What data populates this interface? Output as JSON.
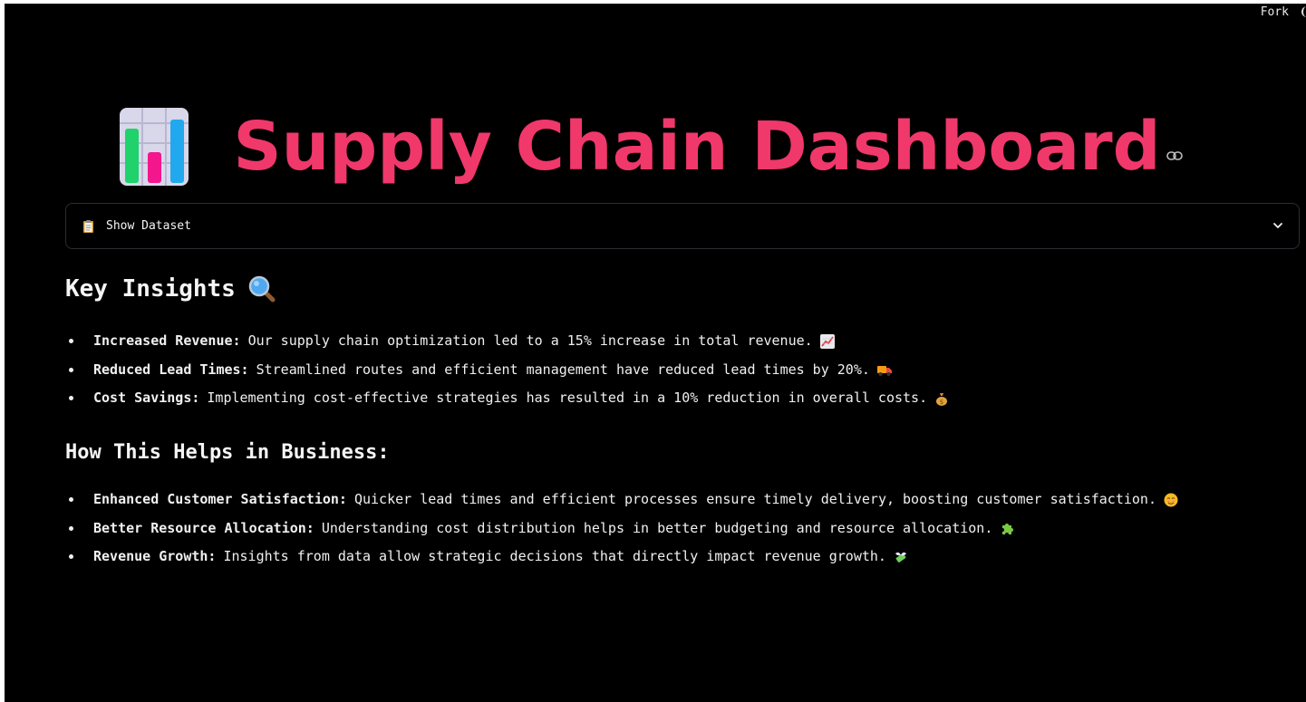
{
  "topbar": {
    "fork_label": "Fork"
  },
  "header": {
    "title": "Supply Chain Dashboard",
    "title_icon": "bar-chart-icon",
    "anchor_icon": "link-icon"
  },
  "expander": {
    "icon": "clipboard-icon",
    "label": "Show Dataset",
    "chevron_icon": "chevron-down-icon"
  },
  "insights": {
    "heading": "Key Insights",
    "heading_icon": "magnifying-glass-icon",
    "items": [
      {
        "title": "Increased Revenue:",
        "text": "Our supply chain optimization led to a 15% increase in total revenue.",
        "icon": "chart-increasing-icon"
      },
      {
        "title": "Reduced Lead Times:",
        "text": "Streamlined routes and efficient management have reduced lead times by 20%.",
        "icon": "delivery-truck-icon"
      },
      {
        "title": "Cost Savings:",
        "text": "Implementing cost-effective strategies has resulted in a 10% reduction in overall costs.",
        "icon": "money-bag-icon"
      }
    ]
  },
  "business": {
    "heading": "How This Helps in Business:",
    "items": [
      {
        "title": "Enhanced Customer Satisfaction:",
        "text": "Quicker lead times and efficient processes ensure timely delivery, boosting customer satisfaction.",
        "icon": "smiling-face-icon"
      },
      {
        "title": "Better Resource Allocation:",
        "text": "Understanding cost distribution helps in better budgeting and resource allocation.",
        "icon": "puzzle-piece-icon"
      },
      {
        "title": "Revenue Growth:",
        "text": "Insights from data allow strategic decisions that directly impact revenue growth.",
        "icon": "money-with-wings-icon"
      }
    ]
  },
  "colors": {
    "background": "#000000",
    "title": "#f0386b",
    "text": "#f5f5f5",
    "border": "#2b2d33"
  }
}
